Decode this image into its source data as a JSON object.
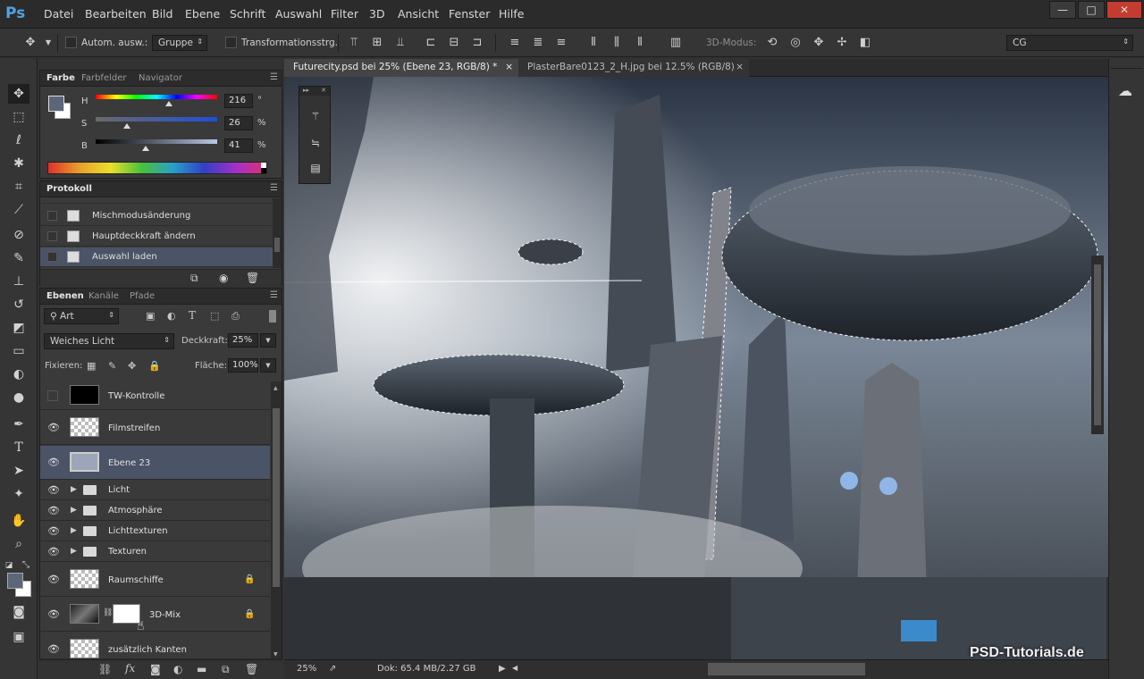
{
  "app": {
    "logo": "Ps"
  },
  "menu": [
    "Datei",
    "Bearbeiten",
    "Bild",
    "Ebene",
    "Schrift",
    "Auswahl",
    "Filter",
    "3D",
    "Ansicht",
    "Fenster",
    "Hilfe"
  ],
  "window_controls": {
    "minimize": "—",
    "maximize": "□",
    "close": "✕"
  },
  "options": {
    "auto_select_label": "Autom. ausw.:",
    "auto_select_value": "Gruppe",
    "transform_label": "Transformationsstrg.",
    "mode3d_label": "3D-Modus:",
    "workspace_value": "CG"
  },
  "color_panel": {
    "tabs": [
      "Farbe",
      "Farbfelder",
      "Navigator"
    ],
    "h_label": "H",
    "h_value": "216",
    "h_unit": "°",
    "h_level": 0.6,
    "s_label": "S",
    "s_value": "26",
    "s_unit": "%",
    "s_level": 0.26,
    "b_label": "B",
    "b_value": "41",
    "b_unit": "%",
    "b_level": 0.41
  },
  "history_panel": {
    "title": "Protokoll",
    "items": [
      {
        "label": "Mischmodusänderung"
      },
      {
        "label": "Hauptdeckkraft ändern"
      },
      {
        "label": "Auswahl laden"
      }
    ]
  },
  "layers_panel": {
    "tabs": [
      "Ebenen",
      "Kanäle",
      "Pfade"
    ],
    "filter_value": "Art",
    "blend_mode": "Weiches Licht",
    "opacity_label": "Deckkraft:",
    "opacity_value": "25%",
    "lock_label": "Fixieren:",
    "fill_label": "Fläche:",
    "fill_value": "100%",
    "layers": [
      {
        "name": "TW-Kontrolle"
      },
      {
        "name": "Filmstreifen"
      },
      {
        "name": "Ebene 23"
      },
      {
        "name": "Licht"
      },
      {
        "name": "Atmosphäre"
      },
      {
        "name": "Lichttexturen"
      },
      {
        "name": "Texturen"
      },
      {
        "name": "Raumschiffe"
      },
      {
        "name": "3D-Mix"
      },
      {
        "name": "zusätzlich Kanten"
      }
    ],
    "bottom_icons": [
      "link-icon",
      "fx-icon",
      "mask-icon",
      "adjustment-icon",
      "folder-icon",
      "new-layer-icon",
      "trash-icon"
    ]
  },
  "documents": {
    "tabs": [
      {
        "label": "Futurecity.psd bei 25% (Ebene 23, RGB/8) *",
        "close": "×"
      },
      {
        "label": "PlasterBare0123_2_H.jpg bei 12.5% (RGB/8)",
        "close": "×"
      }
    ]
  },
  "status": {
    "zoom": "25%",
    "doc": "Dok: 65.4 MB/2.27 GB"
  },
  "watermark": "PSD-Tutorials.de",
  "colors": {
    "accent": "#4b5366",
    "fg_swatch": "#5b6779",
    "bg_swatch": "#ffffff"
  }
}
